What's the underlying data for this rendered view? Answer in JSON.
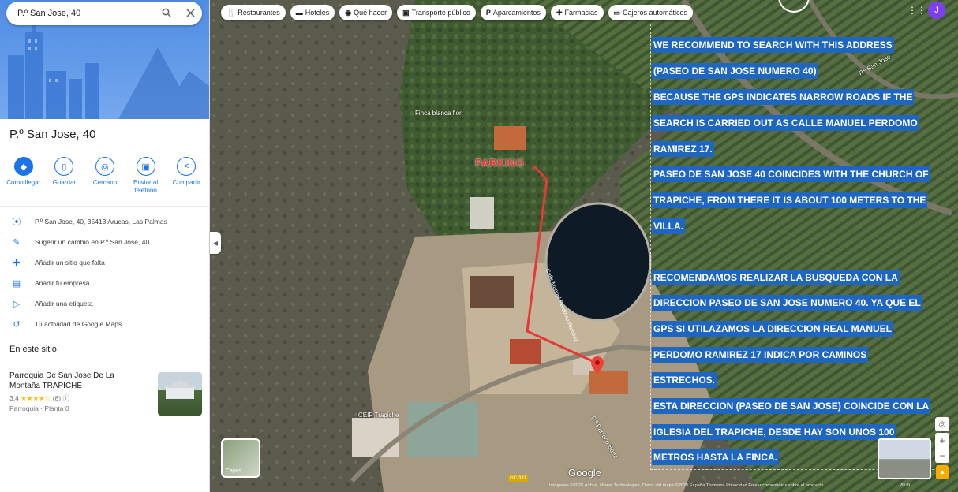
{
  "search": {
    "value": "P.º San Jose, 40"
  },
  "place": {
    "title": "P.º San Jose, 40",
    "actions": [
      {
        "label": "Cómo llegar",
        "icon": "directions-icon"
      },
      {
        "label": "Guardar",
        "icon": "bookmark-icon"
      },
      {
        "label": "Cercano",
        "icon": "nearby-icon"
      },
      {
        "label": "Enviar al teléfono",
        "icon": "send-to-phone-icon"
      },
      {
        "label": "Compartir",
        "icon": "share-icon"
      }
    ],
    "info": [
      {
        "text": "P.º San Jose, 40, 35413 Arucas, Las Palmas",
        "icon": "location-pin-icon"
      },
      {
        "text": "Sugerir un cambio en P.º San Jose, 40",
        "icon": "edit-pencil-icon"
      },
      {
        "text": "Añadir un sitio que falta",
        "icon": "add-place-icon"
      },
      {
        "text": "Añadir tu empresa",
        "icon": "add-business-icon"
      },
      {
        "text": "Añadir una etiqueta",
        "icon": "label-icon"
      },
      {
        "text": "Tu actividad de Google Maps",
        "icon": "history-icon"
      }
    ]
  },
  "site": {
    "heading": "En este sitio",
    "card": {
      "name": "Parroquia De San Jose De La Montaña TRAPICHE",
      "rating": "3,4",
      "stars": "★★★★☆",
      "reviews": "(8)",
      "type": "Parroquia · Planta 0"
    }
  },
  "chips": [
    {
      "label": "Restaurantes",
      "icon": "restaurant-icon",
      "glyph": "🍴"
    },
    {
      "label": "Hoteles",
      "icon": "hotel-icon",
      "glyph": "▬"
    },
    {
      "label": "Qué hacer",
      "icon": "camera-icon",
      "glyph": "◉"
    },
    {
      "label": "Transporte público",
      "icon": "transit-icon",
      "glyph": "▣"
    },
    {
      "label": "Aparcamientos",
      "icon": "parking-icon",
      "glyph": "P"
    },
    {
      "label": "Farmacias",
      "icon": "pharmacy-icon",
      "glyph": "✚"
    },
    {
      "label": "Cajeros automáticos",
      "icon": "atm-icon",
      "glyph": "▭"
    }
  ],
  "user": {
    "initial": "J"
  },
  "map": {
    "labels": {
      "finca": "Finca blanca flor",
      "ceip": "CEIP Trapiche",
      "san_jose": "P.º San Jose",
      "parroco": "P.º Parroco Baez",
      "road": "Calle Manuel Perdomo Ramirez",
      "gc": "GC-331"
    },
    "parking": "PARKING",
    "layers": "Capas",
    "google": "Google",
    "attribution": "Imágenes ©2025 Airbus, Maxar Technologies, Datos del mapa ©2025   España   Términos   Privacidad   Enviar comentarios sobre el producto",
    "scale": "20 m"
  },
  "overlay_lines": [
    "WE RECOMMEND  TO SEARCH WITH THIS ADDRESS",
    "(PASEO DE SAN JOSE NUMERO 40)",
    "BECAUSE THE GPS INDICATES NARROW ROADS IF THE",
    "SEARCH IS CARRIED OUT AS CALLE MANUEL PERDOMO",
    "RAMIREZ 17.",
    "PASEO DE SAN JOSE 40 COINCIDES WITH THE CHURCH OF",
    "TRAPICHE, FROM THERE IT IS ABOUT 100 METERS TO THE",
    "VILLA.",
    "RECOMENDAMOS REALIZAR LA BUSQUEDA CON LA",
    "DIRECCION PASEO DE SAN JOSE NUMERO 40. YA QUE EL",
    "GPS SI UTILAZAMOS LA DIRECCION REAL MANUEL",
    "PERDOMO RAMIREZ 17 INDICA POR CAMINOS",
    "ESTRECHOS.",
    "ESTA DIRECCION (PASEO DE SAN JOSE) COINCIDE CON LA",
    "IGLESIA DEL TRAPICHE, DESDE HAY SON UNOS 100",
    "METROS HASTA LA FINCA."
  ],
  "colors": {
    "accent": "#1a73e8",
    "highlight": "#1f66c1",
    "parking_red": "#e53935"
  }
}
